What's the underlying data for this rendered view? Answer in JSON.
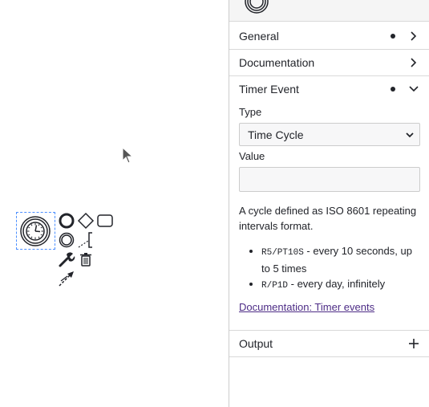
{
  "panel": {
    "groups": {
      "general": {
        "title": "General",
        "has_dot": true,
        "expanded": false,
        "icon": "chevron-right-icon"
      },
      "documentation": {
        "title": "Documentation",
        "has_dot": false,
        "expanded": false,
        "icon": "chevron-right-icon"
      },
      "timer_event": {
        "title": "Timer Event",
        "has_dot": true,
        "expanded": true,
        "icon": "chevron-down-icon",
        "type_label": "Type",
        "type_selected": "Time Cycle",
        "value_label": "Value",
        "value": "",
        "description_intro": "A cycle defined as ISO 8601 repeating intervals format.",
        "examples": [
          {
            "code": "R5/PT10S",
            "text": " - every 10 seconds, up to 5 times"
          },
          {
            "code": "R/P1D",
            "text": " - every day, infinitely"
          }
        ],
        "doc_link": "Documentation: Timer events"
      },
      "output": {
        "title": "Output",
        "icon": "plus-icon"
      }
    }
  },
  "canvas": {
    "selected_element": "timer-start-event",
    "context_pad": [
      "end-event-icon",
      "gateway-icon",
      "task-icon",
      "intermediate-event-icon",
      "text-annotation-icon",
      "wrench-icon",
      "trash-icon",
      "connect-icon"
    ]
  },
  "colors": {
    "selection": "#4d90ff",
    "link": "#4d2c86",
    "border": "#d9d9d9",
    "input_bg": "#f7f7f8"
  }
}
